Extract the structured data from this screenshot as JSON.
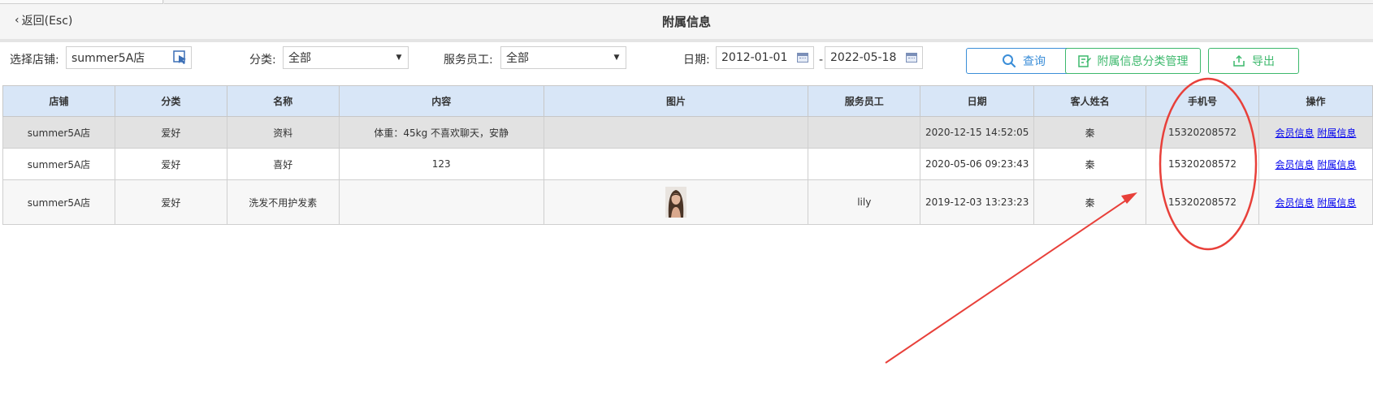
{
  "header": {
    "back_label": "返回(Esc)",
    "title": "附属信息"
  },
  "toolbar": {
    "store_label": "选择店铺:",
    "store_value": "summer5A店",
    "category_label": "分类:",
    "category_value": "全部",
    "staff_label": "服务员工:",
    "staff_value": "全部",
    "date_label": "日期:",
    "date_from": "2012-01-01",
    "date_sep": "-",
    "date_to": "2022-05-18",
    "query_label": "查询",
    "manage_label": "附属信息分类管理",
    "export_label": "导出"
  },
  "table": {
    "headers": [
      "店铺",
      "分类",
      "名称",
      "内容",
      "图片",
      "服务员工",
      "日期",
      "客人姓名",
      "手机号",
      "操作"
    ],
    "rows": [
      {
        "store": "summer5A店",
        "category": "爱好",
        "name": "资料",
        "content": "体重：45kg 不喜欢聊天，安静",
        "image": "",
        "staff": "",
        "date": "2020-12-15 14:52:05",
        "guest": "秦",
        "phone": "15320208572",
        "action1": "会员信息",
        "action2": "附属信息"
      },
      {
        "store": "summer5A店",
        "category": "爱好",
        "name": "喜好",
        "content": "123",
        "image": "",
        "staff": "",
        "date": "2020-05-06 09:23:43",
        "guest": "秦",
        "phone": "15320208572",
        "action1": "会员信息",
        "action2": "附属信息"
      },
      {
        "store": "summer5A店",
        "category": "爱好",
        "name": "洗发不用护发素",
        "content": "",
        "image": "portrait-thumbnail",
        "staff": "lily",
        "date": "2019-12-03 13:23:23",
        "guest": "秦",
        "phone": "15320208572",
        "action1": "会员信息",
        "action2": "附属信息"
      }
    ]
  },
  "colors": {
    "header_bg": "#d8e6f7",
    "accent_blue": "#3b8ed8",
    "accent_green": "#3cb86c",
    "annotation_red": "#e8403a",
    "link": "#0000ee"
  }
}
